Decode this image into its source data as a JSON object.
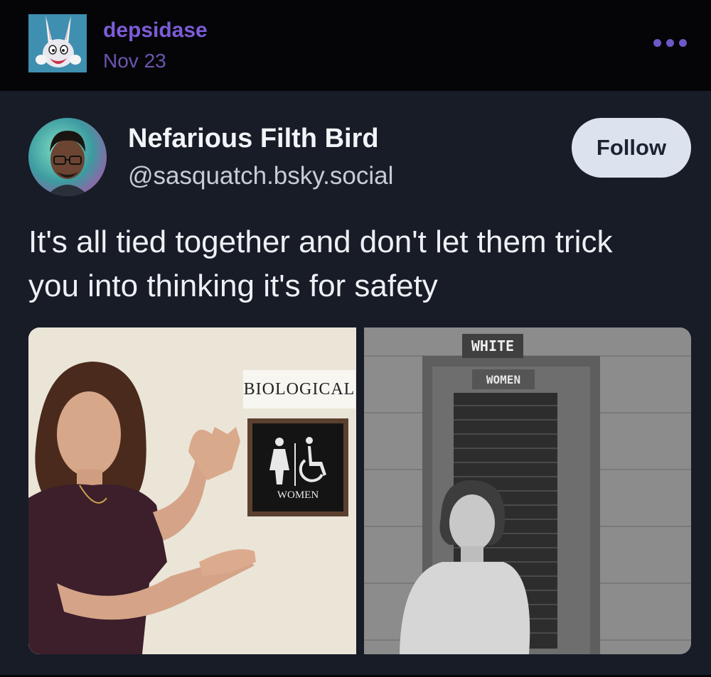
{
  "reblog_header": {
    "username": "depsidase",
    "date": "Nov 23",
    "avatar_icon": "bunny-avatar-icon",
    "more_icon": "ellipsis-icon"
  },
  "embedded_post": {
    "author": {
      "display_name": "Nefarious Filth Bird",
      "handle": "@sasquatch.bsky.social",
      "avatar_icon": "author-avatar-illustration"
    },
    "follow_label": "Follow",
    "text": "It's all tied together and don't let them trick you into thinking it's for safety",
    "images": {
      "left": {
        "sign_label": "BIOLOGICAL",
        "plate_text": "WOMEN"
      },
      "right": {
        "sign_top": "WHITE",
        "sign_bottom": "WOMEN"
      }
    }
  },
  "colors": {
    "header_bg": "#050507",
    "card_bg": "#171c27",
    "username": "#7c5cd6",
    "follow_bg": "#dde3ee"
  }
}
